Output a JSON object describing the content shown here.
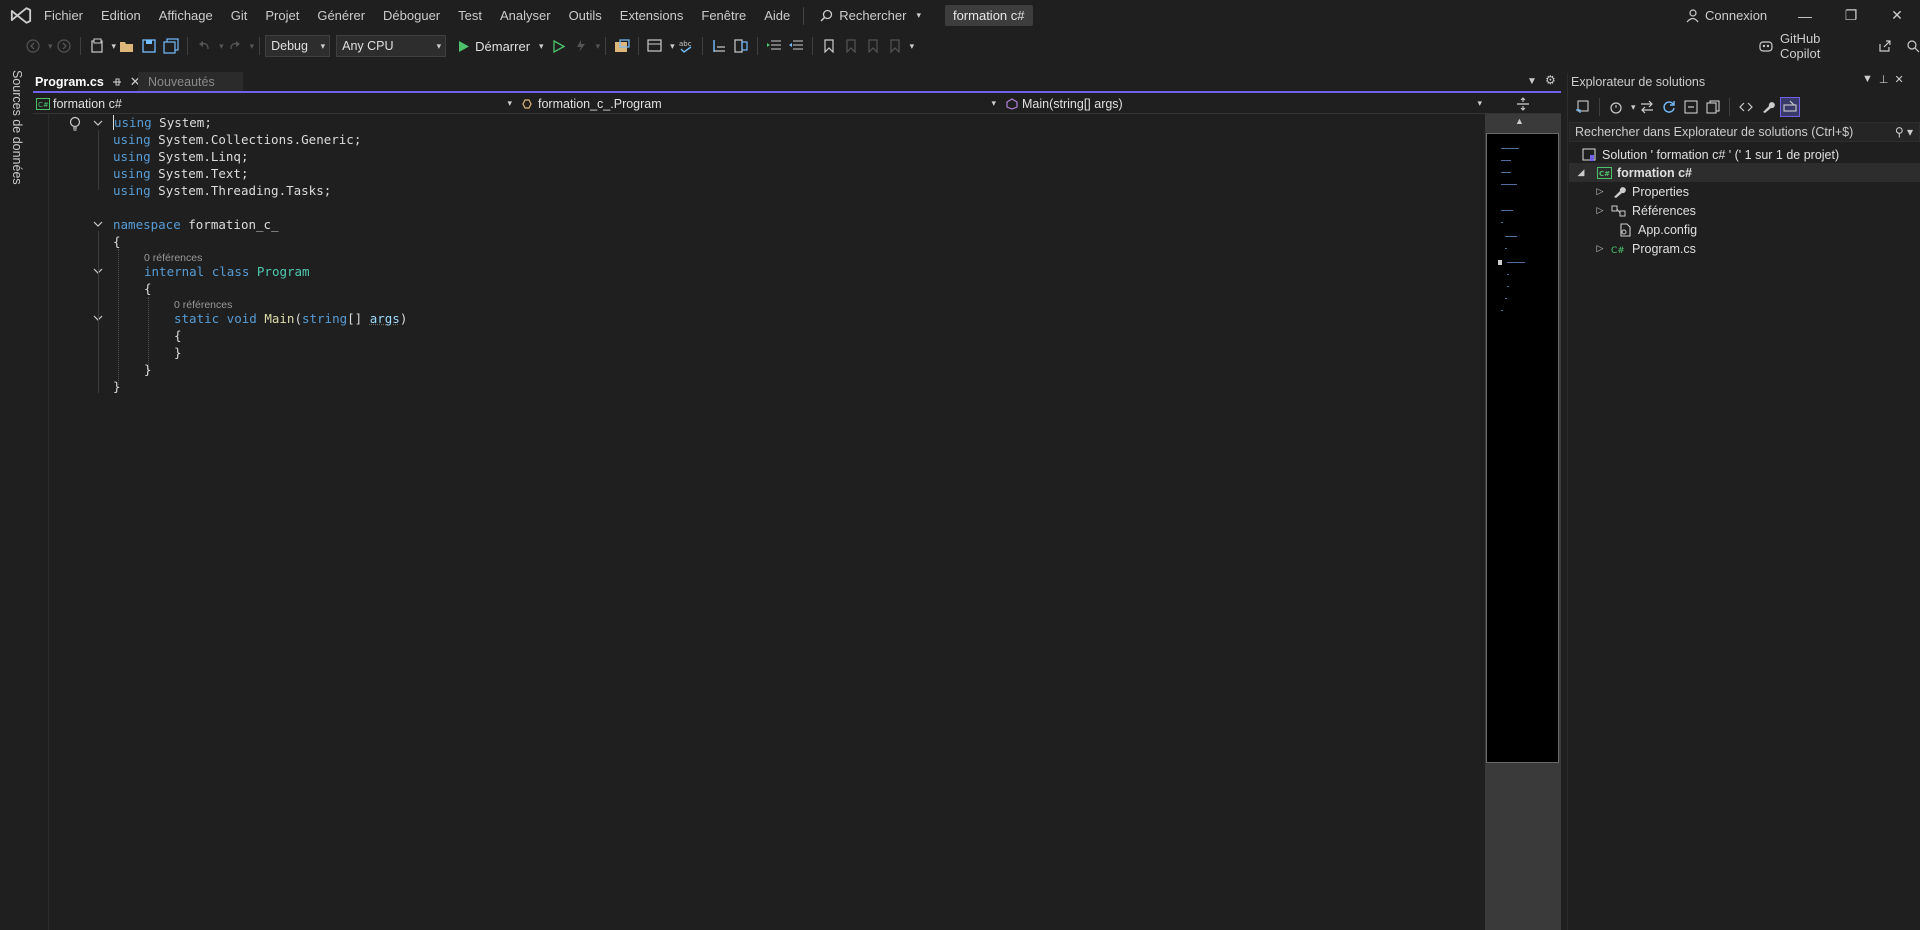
{
  "menubar": {
    "items": [
      "Fichier",
      "Edition",
      "Affichage",
      "Git",
      "Projet",
      "Générer",
      "Déboguer",
      "Test",
      "Analyser",
      "Outils",
      "Extensions",
      "Fenêtre",
      "Aide"
    ],
    "search_label": "Rechercher",
    "solution_name": "formation c#",
    "connexion": "Connexion"
  },
  "toolbar": {
    "configuration": "Debug",
    "platform": "Any CPU",
    "start_label": "Démarrer",
    "copilot_label": "GitHub Copilot"
  },
  "left_strip": {
    "data_sources_label": "Sources de données"
  },
  "tabs": [
    {
      "label": "Program.cs",
      "active": true
    },
    {
      "label": "Nouveautés",
      "active": false
    }
  ],
  "navbar": {
    "project": "formation c#",
    "type": "formation_c_.Program",
    "member": "Main(string[] args)"
  },
  "code": {
    "lines": {
      "l1_kw": "using",
      "l1_rest": " System;",
      "l2_kw": "using",
      "l2_rest": " System.Collections.Generic;",
      "l3_kw": "using",
      "l3_rest": " System.Linq;",
      "l4_kw": "using",
      "l4_rest": " System.Text;",
      "l5_kw": "using",
      "l5_rest": " System.Threading.Tasks;",
      "ns_kw": "namespace",
      "ns_name": " formation_c_",
      "open_brace": "{",
      "close_brace": "}",
      "class_kw1": "internal",
      "class_kw2": " class",
      "class_name": " Program",
      "main_kw1": "static",
      "main_kw2": " void",
      "main_name": " Main",
      "main_p1": "(",
      "main_type": "string",
      "main_p2": "[] ",
      "main_param": "args",
      "main_p3": ")"
    },
    "codelens": [
      "0 références",
      "0 références"
    ]
  },
  "solution_explorer": {
    "title": "Explorateur de solutions",
    "search_placeholder": "Rechercher dans Explorateur de solutions (Ctrl+$)",
    "solution_row": "Solution ' formation c# ' (' 1 sur 1 de projet)",
    "project_row": "formation c#",
    "items": [
      "Properties",
      "Références",
      "App.config",
      "Program.cs"
    ]
  },
  "colors": {
    "accent": "#7160e8",
    "keyword": "#569cd6",
    "type": "#4ec9b0",
    "method": "#dcdcaa",
    "parameter": "#9cdcfe",
    "background": "#1f1f1f"
  }
}
